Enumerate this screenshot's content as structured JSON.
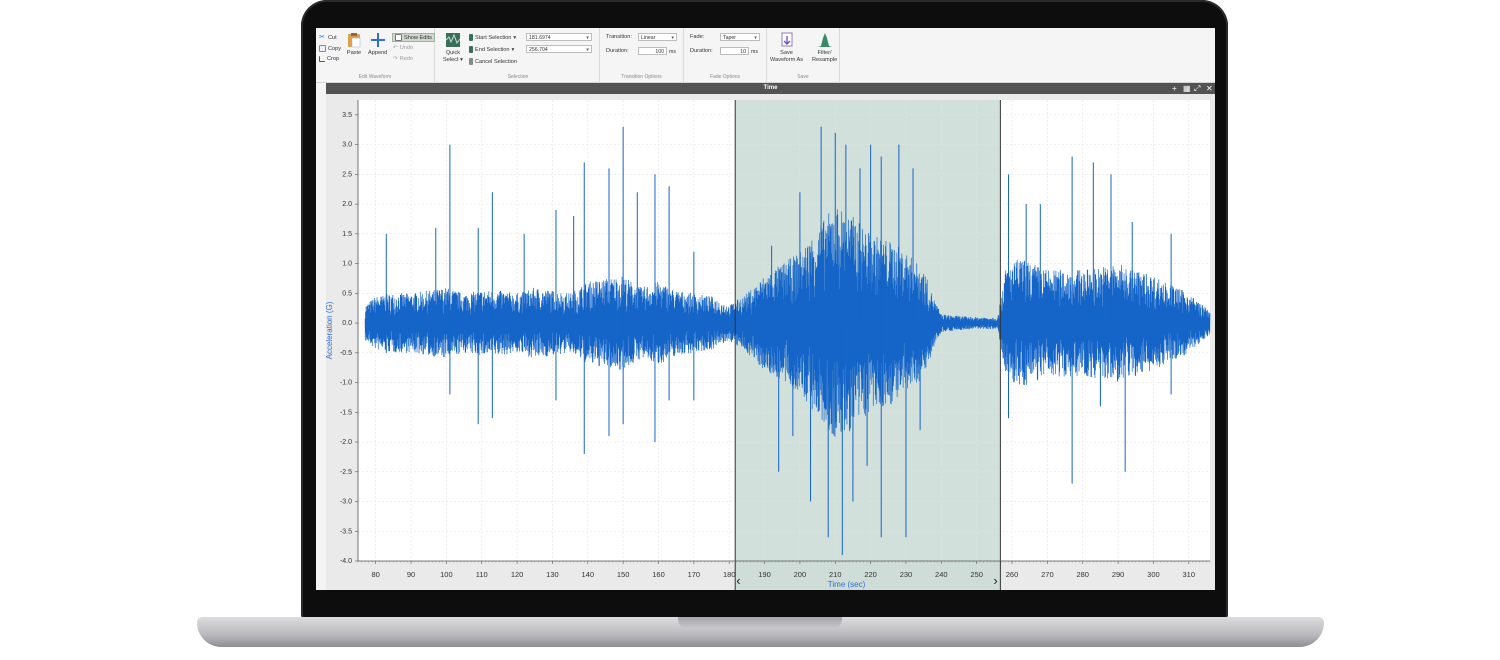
{
  "edit_waveform": {
    "cut": "Cut",
    "copy": "Copy",
    "crop": "Crop",
    "paste": "Paste",
    "append": "Append",
    "show_edits": "Show Edits",
    "undo": "Undo",
    "redo": "Redo",
    "label": "Edit Waveform"
  },
  "selection": {
    "quick_select_1": "Quick",
    "quick_select_2": "Select",
    "start_label": "Start Selection",
    "start_value": "181.6974",
    "end_label": "End Selection",
    "end_value": "256.704",
    "cancel": "Cancel Selection",
    "label": "Selection"
  },
  "transition": {
    "transition_label": "Transition:",
    "transition_value": "Linear",
    "duration_label": "Duration:",
    "duration_value": "100",
    "unit": "ms",
    "label": "Transition Options"
  },
  "fade": {
    "fade_label": "Fade:",
    "fade_value": "Taper",
    "duration_label": "Duration:",
    "duration_value": "10",
    "unit": "ms",
    "label": "Fade Options"
  },
  "save": {
    "save_waveform_1": "Save",
    "save_waveform_2": "Waveform As",
    "filter_1": "Filter/",
    "filter_2": "Resample",
    "label": "Save"
  },
  "panel": {
    "title": "Time"
  },
  "colors": {
    "signal": "#1565c8",
    "selection_fill": "#c9dad3",
    "accent": "#2e6fd1"
  },
  "chart_data": {
    "type": "line",
    "xlabel": "Time (sec)",
    "ylabel": "Acceleration (G)",
    "xlim": [
      75,
      316
    ],
    "ylim": [
      -4.0,
      3.75
    ],
    "x_ticks": [
      80,
      90,
      100,
      110,
      120,
      130,
      140,
      150,
      160,
      170,
      180,
      190,
      200,
      210,
      220,
      230,
      240,
      250,
      260,
      270,
      280,
      290,
      300,
      310
    ],
    "y_ticks": [
      "3.5",
      "3.0",
      "2.5",
      "2.0",
      "1.5",
      "1.0",
      "0.5",
      "0.0",
      "-0.5",
      "-1.0",
      "-1.5",
      "-2.0",
      "-2.5",
      "-3.0",
      "-3.5",
      "-4.0"
    ],
    "selection": {
      "start": 181.6974,
      "end": 256.704
    },
    "grid": true,
    "series": [
      {
        "envelope": [
          {
            "t": 75,
            "amp": 0.2
          },
          {
            "t": 80,
            "amp": 0.45
          },
          {
            "t": 85,
            "amp": 0.5
          },
          {
            "t": 90,
            "amp": 0.5
          },
          {
            "t": 95,
            "amp": 0.55
          },
          {
            "t": 100,
            "amp": 0.6
          },
          {
            "t": 105,
            "amp": 0.5
          },
          {
            "t": 110,
            "amp": 0.55
          },
          {
            "t": 115,
            "amp": 0.55
          },
          {
            "t": 120,
            "amp": 0.5
          },
          {
            "t": 125,
            "amp": 0.6
          },
          {
            "t": 130,
            "amp": 0.55
          },
          {
            "t": 135,
            "amp": 0.5
          },
          {
            "t": 140,
            "amp": 0.7
          },
          {
            "t": 145,
            "amp": 0.75
          },
          {
            "t": 150,
            "amp": 0.8
          },
          {
            "t": 155,
            "amp": 0.6
          },
          {
            "t": 160,
            "amp": 0.7
          },
          {
            "t": 165,
            "amp": 0.55
          },
          {
            "t": 170,
            "amp": 0.5
          },
          {
            "t": 175,
            "amp": 0.45
          },
          {
            "t": 180,
            "amp": 0.3
          },
          {
            "t": 185,
            "amp": 0.5
          },
          {
            "t": 190,
            "amp": 0.8
          },
          {
            "t": 195,
            "amp": 1.0
          },
          {
            "t": 200,
            "amp": 1.2
          },
          {
            "t": 205,
            "amp": 1.6
          },
          {
            "t": 210,
            "amp": 2.0
          },
          {
            "t": 215,
            "amp": 1.8
          },
          {
            "t": 220,
            "amp": 1.5
          },
          {
            "t": 225,
            "amp": 1.4
          },
          {
            "t": 230,
            "amp": 1.2
          },
          {
            "t": 235,
            "amp": 0.9
          },
          {
            "t": 238,
            "amp": 0.4
          },
          {
            "t": 240,
            "amp": 0.15
          },
          {
            "t": 245,
            "amp": 0.12
          },
          {
            "t": 250,
            "amp": 0.1
          },
          {
            "t": 256,
            "amp": 0.1
          },
          {
            "t": 258,
            "amp": 0.9
          },
          {
            "t": 262,
            "amp": 1.1
          },
          {
            "t": 270,
            "amp": 0.9
          },
          {
            "t": 280,
            "amp": 0.9
          },
          {
            "t": 290,
            "amp": 1.0
          },
          {
            "t": 300,
            "amp": 0.8
          },
          {
            "t": 310,
            "amp": 0.5
          },
          {
            "t": 316,
            "amp": 0.2
          }
        ],
        "spikes": [
          {
            "t": 83,
            "y": 1.5
          },
          {
            "t": 83,
            "y": -0.5
          },
          {
            "t": 97,
            "y": 1.6
          },
          {
            "t": 101,
            "y": 3.0
          },
          {
            "t": 101,
            "y": -1.2
          },
          {
            "t": 109,
            "y": 1.6
          },
          {
            "t": 109,
            "y": -1.7
          },
          {
            "t": 113,
            "y": 2.2
          },
          {
            "t": 113,
            "y": -1.6
          },
          {
            "t": 122,
            "y": 1.5
          },
          {
            "t": 131,
            "y": 1.9
          },
          {
            "t": 131,
            "y": -1.3
          },
          {
            "t": 136,
            "y": 1.8
          },
          {
            "t": 139,
            "y": 2.7
          },
          {
            "t": 139,
            "y": -2.2
          },
          {
            "t": 146,
            "y": 2.6
          },
          {
            "t": 146,
            "y": -1.9
          },
          {
            "t": 150,
            "y": 3.3
          },
          {
            "t": 150,
            "y": -1.7
          },
          {
            "t": 154,
            "y": 2.2
          },
          {
            "t": 159,
            "y": 2.5
          },
          {
            "t": 159,
            "y": -2.0
          },
          {
            "t": 163,
            "y": 2.3
          },
          {
            "t": 163,
            "y": -1.3
          },
          {
            "t": 170,
            "y": 1.2
          },
          {
            "t": 170,
            "y": -1.3
          },
          {
            "t": 192,
            "y": 1.3
          },
          {
            "t": 194,
            "y": -2.5
          },
          {
            "t": 198,
            "y": -1.9
          },
          {
            "t": 200,
            "y": 2.2
          },
          {
            "t": 203,
            "y": -3.0
          },
          {
            "t": 206,
            "y": 3.3
          },
          {
            "t": 208,
            "y": -3.6
          },
          {
            "t": 210,
            "y": 3.2
          },
          {
            "t": 212,
            "y": -3.9
          },
          {
            "t": 213,
            "y": 3.0
          },
          {
            "t": 215,
            "y": -3.0
          },
          {
            "t": 217,
            "y": 2.6
          },
          {
            "t": 219,
            "y": -2.4
          },
          {
            "t": 220,
            "y": 3.0
          },
          {
            "t": 223,
            "y": 2.8
          },
          {
            "t": 223,
            "y": -3.6
          },
          {
            "t": 228,
            "y": 3.0
          },
          {
            "t": 230,
            "y": -3.6
          },
          {
            "t": 232,
            "y": 2.6
          },
          {
            "t": 234,
            "y": -1.8
          },
          {
            "t": 259,
            "y": 2.5
          },
          {
            "t": 259,
            "y": -1.6
          },
          {
            "t": 264,
            "y": 2.0
          },
          {
            "t": 268,
            "y": 2.0
          },
          {
            "t": 277,
            "y": 2.8
          },
          {
            "t": 277,
            "y": -2.7
          },
          {
            "t": 283,
            "y": 2.7
          },
          {
            "t": 285,
            "y": -1.4
          },
          {
            "t": 288,
            "y": 2.5
          },
          {
            "t": 292,
            "y": -2.5
          },
          {
            "t": 294,
            "y": 1.7
          },
          {
            "t": 305,
            "y": 1.5
          },
          {
            "t": 305,
            "y": -1.2
          }
        ]
      }
    ]
  }
}
